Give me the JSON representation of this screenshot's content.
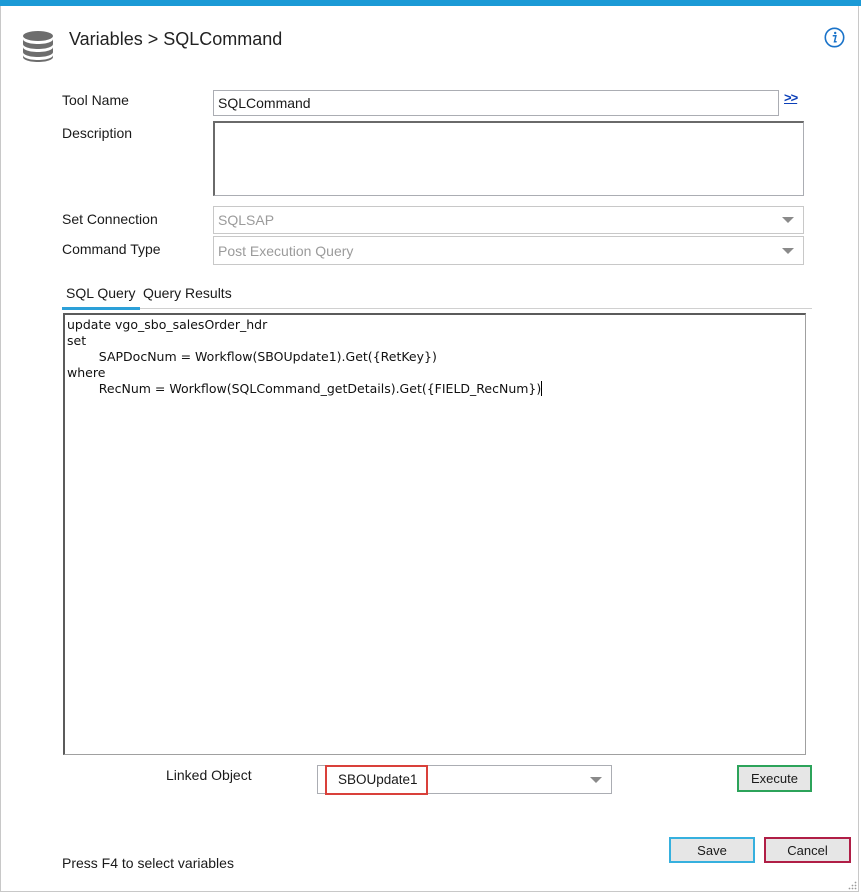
{
  "header": {
    "title": "Variables > SQLCommand",
    "icon": "database-icon",
    "info_icon": "info-icon"
  },
  "form": {
    "tool_name_label": "Tool Name",
    "tool_name_value": "SQLCommand",
    "expand_link": ">>",
    "description_label": "Description",
    "description_value": "",
    "set_connection_label": "Set Connection",
    "set_connection_value": "SQLSAP",
    "command_type_label": "Command Type",
    "command_type_value": "Post Execution Query"
  },
  "tabs": [
    {
      "label": "SQL Query",
      "active": true
    },
    {
      "label": "Query Results",
      "active": false
    }
  ],
  "editor": {
    "lines": [
      "update vgo_sbo_salesOrder_hdr",
      "set",
      "        SAPDocNum = Workflow(SBOUpdate1).Get({RetKey})",
      "where",
      "        RecNum = Workflow(SQLCommand_getDetails).Get({FIELD_RecNum})"
    ]
  },
  "linked": {
    "label": "Linked Object",
    "value": "SBOUpdate1",
    "execute_label": "Execute"
  },
  "footer": {
    "hint": "Press F4 to select variables",
    "save_label": "Save",
    "cancel_label": "Cancel"
  },
  "colors": {
    "accent": "#1b9ad6",
    "execute_border": "#2ca35a",
    "save_border": "#36b0de",
    "cancel_border": "#b01e46",
    "highlight": "#d9403a"
  }
}
